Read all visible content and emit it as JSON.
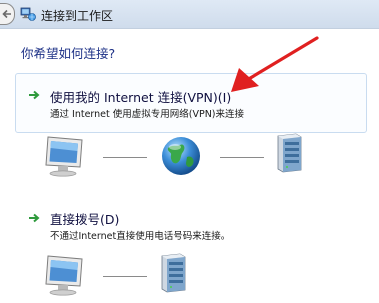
{
  "window": {
    "title": "连接到工作区"
  },
  "prompt": "你希望如何连接?",
  "options": [
    {
      "title": "使用我的 Internet 连接(VPN)(I)",
      "description": "通过 Internet 使用虚拟专用网络(VPN)来连接"
    },
    {
      "title": "直接拨号(D)",
      "description": "不通过Internet直接使用电话号码来连接。"
    }
  ],
  "icons": {
    "back": "back-arrow-icon",
    "title": "network-connection-icon",
    "option": "green-arrow-icon",
    "computer": "computer-icon",
    "globe": "globe-icon",
    "server": "server-icon",
    "annotation": "red-annotation-arrow"
  },
  "colors": {
    "prompt": "#1e3287",
    "option_arrow": "#2e9a3c",
    "annotation": "#e02020"
  }
}
